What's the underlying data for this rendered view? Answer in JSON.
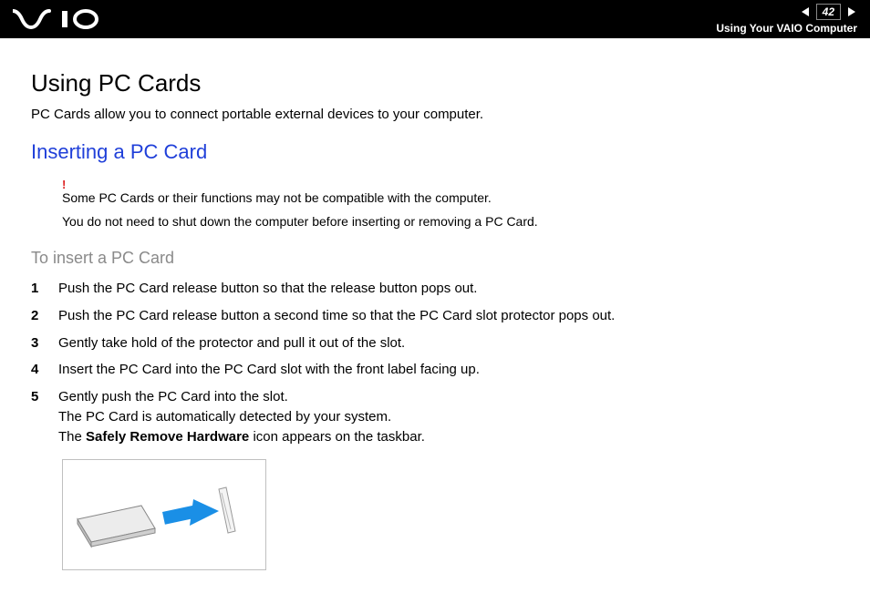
{
  "header": {
    "page_number": "42",
    "breadcrumb": "Using Your VAIO Computer"
  },
  "content": {
    "title": "Using PC Cards",
    "intro": "PC Cards allow you to connect portable external devices to your computer.",
    "section_title": "Inserting a PC Card",
    "note1": "Some PC Cards or their functions may not be compatible with the computer.",
    "note2": "You do not need to shut down the computer before inserting or removing a PC Card.",
    "sub_title": "To insert a PC Card",
    "steps": [
      "Push the PC Card release button so that the release button pops out.",
      "Push the PC Card release button a second time so that the PC Card slot protector pops out.",
      "Gently take hold of the protector and pull it out of the slot.",
      "Insert the PC Card into the PC Card slot with the front label facing up."
    ],
    "step5_line1": "Gently push the PC Card into the slot.",
    "step5_line2": "The PC Card is automatically detected by your system.",
    "step5_line3_pre": "The ",
    "step5_line3_bold": "Safely Remove Hardware",
    "step5_line3_post": " icon appears on the taskbar."
  }
}
